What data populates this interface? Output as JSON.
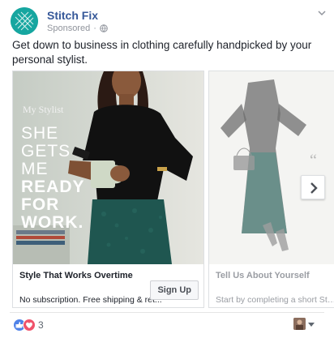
{
  "post": {
    "brand_name": "Stitch Fix",
    "meta_label": "Sponsored",
    "meta_separator": "·",
    "caption": "Get down to business in clothing carefully handpicked by your personal stylist."
  },
  "cards": [
    {
      "overlay_small": "My Stylist",
      "overlay_lines": [
        "SHE",
        "GETS",
        "ME"
      ],
      "overlay_bold_lines": [
        "READY",
        "FOR",
        "WORK."
      ],
      "title": "Style That Works Overtime",
      "subtitle": "No subscription. Free shipping & ret...",
      "cta_label": "Sign Up"
    },
    {
      "title": "Tell Us About Yourself",
      "subtitle": "Start by completing a short Style"
    }
  ],
  "footer": {
    "reaction_count": "3"
  },
  "colors": {
    "brand_teal": "#16a6a0",
    "link_blue": "#365899",
    "skirt_green": "#1f5650"
  },
  "icons": {
    "brand_logo": "stitch-fix-logo-icon",
    "audience": "globe-icon",
    "menu": "chevron-down-icon",
    "next": "chevron-right-icon",
    "like": "like-icon",
    "love": "love-icon"
  }
}
